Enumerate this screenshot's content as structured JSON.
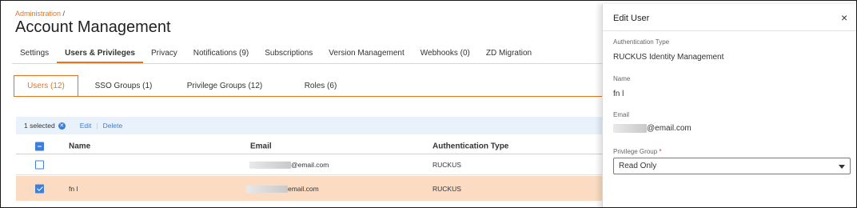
{
  "breadcrumb": {
    "link": "Administration",
    "sep": " /"
  },
  "page_title": "Account Management",
  "tabs": [
    {
      "label": "Settings"
    },
    {
      "label": "Users & Privileges"
    },
    {
      "label": "Privacy"
    },
    {
      "label": "Notifications (9)"
    },
    {
      "label": "Subscriptions"
    },
    {
      "label": "Version Management"
    },
    {
      "label": "Webhooks (0)"
    },
    {
      "label": "ZD Migration"
    }
  ],
  "active_tab": "Users & Privileges",
  "subtabs": [
    {
      "label": "Users (12)"
    },
    {
      "label": "SSO Groups (1)"
    },
    {
      "label": "Privilege Groups (12)"
    },
    {
      "label": "Roles (6)"
    }
  ],
  "active_subtab": "Users (12)",
  "selection_bar": {
    "count": "1 selected",
    "clear_icon": "close-circle-icon",
    "edit": "Edit",
    "delete": "Delete"
  },
  "table": {
    "headers": {
      "name": "Name",
      "email": "Email",
      "auth_type": "Authentication Type"
    },
    "rows": [
      {
        "name": "",
        "email_suffix": "@email.com",
        "auth_type": "RUCKUS",
        "selected": false
      },
      {
        "name": "fn l",
        "email_suffix": "email.com",
        "auth_type": "RUCKUS",
        "selected": true
      }
    ]
  },
  "drawer": {
    "title": "Edit User",
    "close_icon": "close-icon",
    "auth_type_label": "Authentication Type",
    "auth_type_value": "RUCKUS Identity Management",
    "name_label": "Name",
    "name_value": "fn l",
    "email_label": "Email",
    "email_suffix": "@email.com",
    "privilege_label": "Privilege Group",
    "required_mark": "*",
    "privilege_value": "Read Only"
  },
  "colors": {
    "accent": "#e8731d",
    "link_blue": "#3d7fd9",
    "selected_row": "#fbdcc2",
    "selection_bar": "#e9f1fb"
  }
}
